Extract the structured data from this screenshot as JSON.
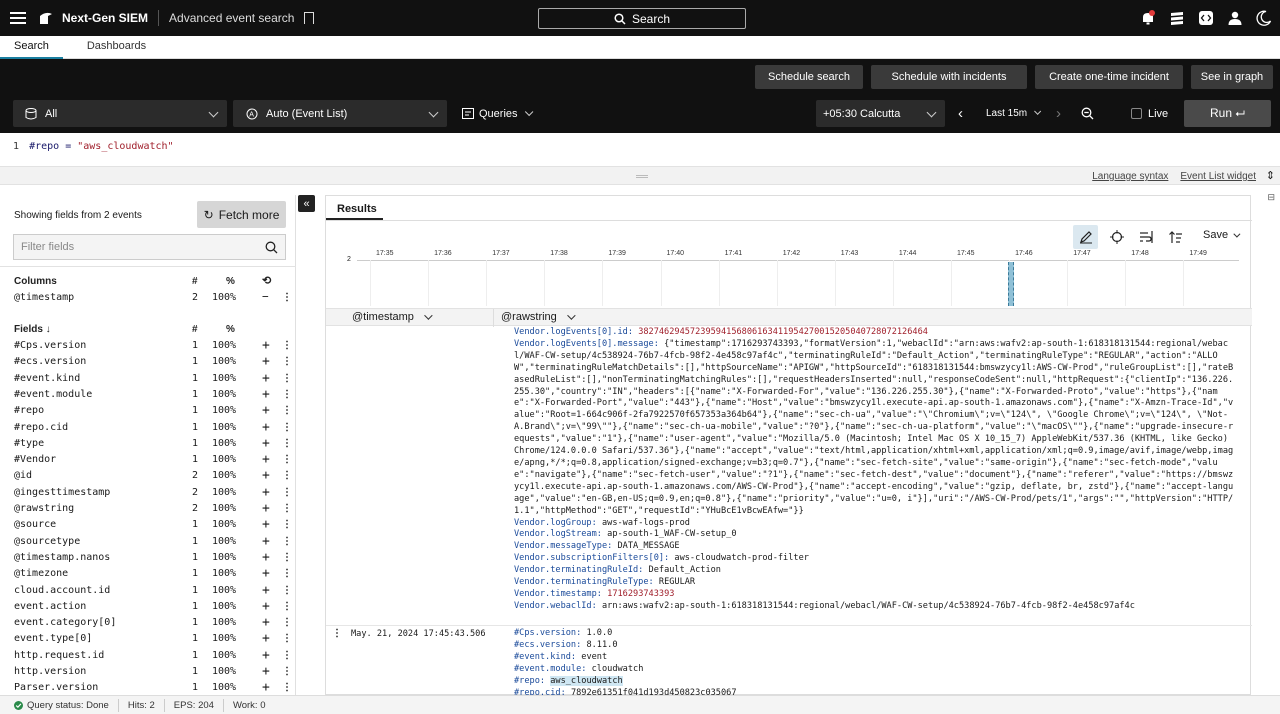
{
  "topbar": {
    "brand": "Next-Gen SIEM",
    "section": "Advanced event search",
    "search_label": "Search"
  },
  "nav": {
    "tabs": [
      "Search",
      "Dashboards"
    ]
  },
  "actions": {
    "schedule_search": "Schedule search",
    "schedule_incidents": "Schedule with incidents",
    "one_time_incident": "Create one-time incident",
    "see_graph": "See in graph"
  },
  "controls": {
    "repo": "All",
    "mode": "Auto (Event List)",
    "queries": "Queries",
    "timezone": "+05:30 Calcutta",
    "range": "Last 15m",
    "live": "Live",
    "run": "Run ⮠"
  },
  "editor": {
    "line_number": "1",
    "field": "#repo",
    "op": " = ",
    "value": "\"aws_cloudwatch\""
  },
  "links": {
    "syntax": "Language syntax",
    "widget": "Event List widget"
  },
  "sidebar": {
    "showing": "Showing fields from 2 events",
    "fetch_more": "Fetch more",
    "filter_placeholder": "Filter fields",
    "columns_header": "Columns",
    "count_header": "#",
    "pct_header": "%",
    "columns": [
      {
        "name": "@timestamp",
        "count": "2",
        "pct": "100%"
      }
    ],
    "fields_header": "Fields ↓",
    "fields": [
      {
        "name": "#Cps.version",
        "count": "1",
        "pct": "100%"
      },
      {
        "name": "#ecs.version",
        "count": "1",
        "pct": "100%"
      },
      {
        "name": "#event.kind",
        "count": "1",
        "pct": "100%"
      },
      {
        "name": "#event.module",
        "count": "1",
        "pct": "100%"
      },
      {
        "name": "#repo",
        "count": "1",
        "pct": "100%"
      },
      {
        "name": "#repo.cid",
        "count": "1",
        "pct": "100%"
      },
      {
        "name": "#type",
        "count": "1",
        "pct": "100%"
      },
      {
        "name": "#Vendor",
        "count": "1",
        "pct": "100%"
      },
      {
        "name": "@id",
        "count": "2",
        "pct": "100%"
      },
      {
        "name": "@ingesttimestamp",
        "count": "2",
        "pct": "100%"
      },
      {
        "name": "@rawstring",
        "count": "2",
        "pct": "100%"
      },
      {
        "name": "@source",
        "count": "1",
        "pct": "100%"
      },
      {
        "name": "@sourcetype",
        "count": "1",
        "pct": "100%"
      },
      {
        "name": "@timestamp.nanos",
        "count": "1",
        "pct": "100%"
      },
      {
        "name": "@timezone",
        "count": "1",
        "pct": "100%"
      },
      {
        "name": "cloud.account.id",
        "count": "1",
        "pct": "100%"
      },
      {
        "name": "event.action",
        "count": "1",
        "pct": "100%"
      },
      {
        "name": "event.category[0]",
        "count": "1",
        "pct": "100%"
      },
      {
        "name": "event.type[0]",
        "count": "1",
        "pct": "100%"
      },
      {
        "name": "http.request.id",
        "count": "1",
        "pct": "100%"
      },
      {
        "name": "http.version",
        "count": "1",
        "pct": "100%"
      },
      {
        "name": "Parser.version",
        "count": "1",
        "pct": "100%"
      }
    ]
  },
  "results": {
    "tab": "Results",
    "save": "Save",
    "histogram": {
      "y_label": "2",
      "ticks": [
        "17:35",
        "17:36",
        "17:37",
        "17:38",
        "17:39",
        "17:40",
        "17:41",
        "17:42",
        "17:43",
        "17:44",
        "17:45",
        "17:46",
        "17:47",
        "17:48",
        "17:49"
      ]
    },
    "col_timestamp": "@timestamp",
    "col_rawstring": "@rawstring",
    "event1": [
      {
        "k": "Vendor.logEvents[0].id:",
        "v": "38274629457239594156806163411954270015205040728072126464",
        "style": "red"
      },
      {
        "k": "Vendor.logEvents[0].message:",
        "v": "{\"timestamp\":1716293743393,\"formatVersion\":1,\"webaclId\":\"arn:aws:wafv2:ap-south-1:618318131544:regional/webacl/WAF-CW-setup/4c538924-76b7-4fcb-98f2-4e458c97af4c\",\"terminatingRuleId\":\"Default_Action\",\"terminatingRuleType\":\"REGULAR\",\"action\":\"ALLOW\",\"terminatingRuleMatchDetails\":[],\"httpSourceName\":\"APIGW\",\"httpSourceId\":\"618318131544:bmswzycy1l:AWS-CW-Prod\",\"ruleGroupList\":[],\"rateBasedRuleList\":[],\"nonTerminatingMatchingRules\":[],\"requestHeadersInserted\":null,\"responseCodeSent\":null,\"httpRequest\":{\"clientIp\":\"136.226.255.30\",\"country\":\"IN\",\"headers\":[{\"name\":\"X-Forwarded-For\",\"value\":\"136.226.255.30\"},{\"name\":\"X-Forwarded-Proto\",\"value\":\"https\"},{\"name\":\"X-Forwarded-Port\",\"value\":\"443\"},{\"name\":\"Host\",\"value\":\"bmswzycy1l.execute-api.ap-south-1.amazonaws.com\"},{\"name\":\"X-Amzn-Trace-Id\",\"value\":\"Root=1-664c906f-2fa7922570f657353a364b64\"},{\"name\":\"sec-ch-ua\",\"value\":\"\\\"Chromium\\\";v=\\\"124\\\", \\\"Google Chrome\\\";v=\\\"124\\\", \\\"Not-A.Brand\\\";v=\\\"99\\\"\"},{\"name\":\"sec-ch-ua-mobile\",\"value\":\"?0\"},{\"name\":\"sec-ch-ua-platform\",\"value\":\"\\\"macOS\\\"\"},{\"name\":\"upgrade-insecure-requests\",\"value\":\"1\"},{\"name\":\"user-agent\",\"value\":\"Mozilla/5.0 (Macintosh; Intel Mac OS X 10_15_7) AppleWebKit/537.36 (KHTML, like Gecko) Chrome/124.0.0.0 Safari/537.36\"},{\"name\":\"accept\",\"value\":\"text/html,application/xhtml+xml,application/xml;q=0.9,image/avif,image/webp,image/apng,*/*;q=0.8,application/signed-exchange;v=b3;q=0.7\"},{\"name\":\"sec-fetch-site\",\"value\":\"same-origin\"},{\"name\":\"sec-fetch-mode\",\"value\":\"navigate\"},{\"name\":\"sec-fetch-user\",\"value\":\"?1\"},{\"name\":\"sec-fetch-dest\",\"value\":\"document\"},{\"name\":\"referer\",\"value\":\"https://bmswzycy1l.execute-api.ap-south-1.amazonaws.com/AWS-CW-Prod\"},{\"name\":\"accept-encoding\",\"value\":\"gzip, deflate, br, zstd\"},{\"name\":\"accept-language\",\"value\":\"en-GB,en-US;q=0.9,en;q=0.8\"},{\"name\":\"priority\",\"value\":\"u=0, i\"}],\"uri\":\"/AWS-CW-Prod/pets/1\",\"args\":\"\",\"httpVersion\":\"HTTP/1.1\",\"httpMethod\":\"GET\",\"requestId\":\"YHuBcE1vBcwEAfw=\"}}",
        "style": "plain"
      },
      {
        "k": "Vendor.logGroup:",
        "v": "aws-waf-logs-prod",
        "style": "plain"
      },
      {
        "k": "Vendor.logStream:",
        "v": "ap-south-1_WAF-CW-setup_0",
        "style": "plain"
      },
      {
        "k": "Vendor.messageType:",
        "v": "DATA_MESSAGE",
        "style": "plain"
      },
      {
        "k": "Vendor.subscriptionFilters[0]:",
        "v": "aws-cloudwatch-prod-filter",
        "style": "plain"
      },
      {
        "k": "Vendor.terminatingRuleId:",
        "v": "Default_Action",
        "style": "plain"
      },
      {
        "k": "Vendor.terminatingRuleType:",
        "v": "REGULAR",
        "style": "plain"
      },
      {
        "k": "Vendor.timestamp:",
        "v": "1716293743393",
        "style": "red"
      },
      {
        "k": "Vendor.webaclId:",
        "v": "arn:aws:wafv2:ap-south-1:618318131544:regional/webacl/WAF-CW-setup/4c538924-76b7-4fcb-98f2-4e458c97af4c",
        "style": "plain"
      }
    ],
    "event2_time": "May. 21, 2024 17:45:43.506",
    "event2": [
      {
        "k": "#Cps.version:",
        "v": "1.0.0",
        "style": "plain"
      },
      {
        "k": "#ecs.version:",
        "v": "8.11.0",
        "style": "plain"
      },
      {
        "k": "#event.kind:",
        "v": "event",
        "style": "plain"
      },
      {
        "k": "#event.module:",
        "v": "cloudwatch",
        "style": "plain"
      },
      {
        "k": "#repo:",
        "v": "aws_cloudwatch",
        "style": "hl"
      },
      {
        "k": "#repo.cid:",
        "v": "7892e61351f041d193d450823c035067",
        "style": "plain"
      }
    ]
  },
  "status": {
    "query_status": "Query status: Done",
    "hits": "Hits: 2",
    "eps": "EPS: 204",
    "work": "Work: 0"
  }
}
